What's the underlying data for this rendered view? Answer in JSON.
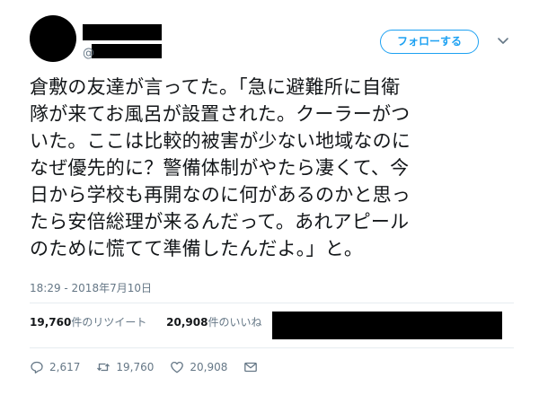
{
  "user": {
    "handle_prefix": "@"
  },
  "follow_button": {
    "label": "フォローする"
  },
  "tweet": {
    "lines": [
      "倉敷の友達が言ってた。「急に避難所に自衛",
      "隊が来てお風呂が設置された。クーラーがつ",
      "いた。ここは比較的被害が少ない地域なのに",
      "なぜ優先的に？警備体制がやたら凄くて、今",
      "日から学校も再開なのに何があるのかと思っ",
      "たら安倍総理が来るんだって。あれアピール",
      "のために慌てて準備したんだよ。」と。"
    ],
    "timestamp": "18:29 - 2018年7月10日"
  },
  "stats": {
    "retweets_count": "19,760",
    "retweets_label": "件のリツイート",
    "likes_count": "20,908",
    "likes_label": "件のいいね"
  },
  "actions": {
    "reply_count": "2,617",
    "retweet_count": "19,760",
    "like_count": "20,908"
  },
  "colors": {
    "accent": "#1da1f2",
    "muted": "#657786",
    "text": "#14171a",
    "divider": "#e6ecf0"
  }
}
